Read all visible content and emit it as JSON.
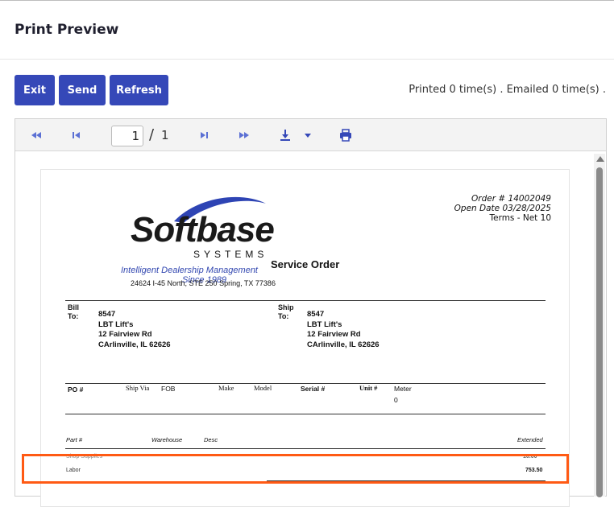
{
  "header": {
    "title": "Print Preview"
  },
  "actions": {
    "exit": "Exit",
    "send": "Send",
    "refresh": "Refresh"
  },
  "status_text": "Printed 0 time(s) . Emailed 0 time(s) .",
  "toolbar": {
    "page_current": "1",
    "page_separator": "/",
    "page_total": "1"
  },
  "icons": {
    "first": "first-page-icon",
    "prev": "previous-page-icon",
    "next": "next-page-icon",
    "last": "last-page-icon",
    "download": "download-icon",
    "dropdown": "chevron-down-icon",
    "print": "print-icon"
  },
  "colors": {
    "button": "#3548b8",
    "accent_text": "#3247b0",
    "highlight": "#ff5a14"
  },
  "report": {
    "order_number": "Order # 14002049",
    "open_date": "Open Date 03/28/2025",
    "terms": "Terms - Net 10",
    "logo_main": "Softbase",
    "logo_sub": "SYSTEMS",
    "tagline_1": "Intelligent Dealership Management",
    "tagline_2": "Since 1989",
    "address": "24624 I-45 North, STE 250 Spring, TX 77386",
    "doc_title": "Service Order",
    "bill_label_1": "Bill",
    "bill_label_2": "To:",
    "ship_label_1": "Ship",
    "ship_label_2": "To:",
    "bill_to": [
      "8547",
      "LBT Lift's",
      "12 Fairview Rd",
      "CArlinville, IL 62626"
    ],
    "ship_to": [
      "8547",
      "LBT Lift's",
      "12 Fairview Rd",
      "CArlinville, IL 62626"
    ],
    "info_cols": {
      "po": "PO #",
      "ship_via": "Ship Via",
      "fob": "FOB",
      "make": "Make",
      "model": "Model",
      "serial": "Serial #",
      "unit": "Unit #",
      "meter": "Meter",
      "meter_value": "0"
    },
    "table_cols": {
      "part": "Part #",
      "warehouse": "Warehouse",
      "desc": "Desc",
      "extended": "Extended"
    },
    "line_items": [
      {
        "name": "Shop Supplies",
        "amount": "10.00"
      },
      {
        "name": "Labor",
        "amount": "753.50"
      }
    ]
  }
}
